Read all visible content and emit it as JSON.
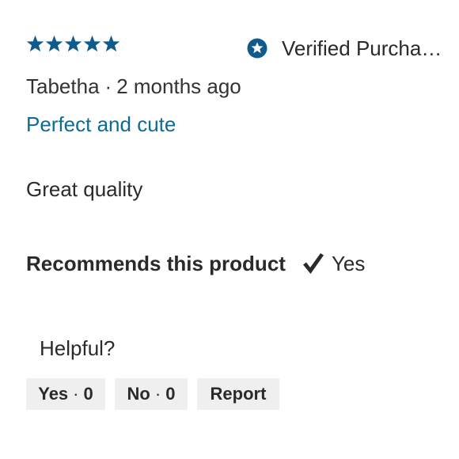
{
  "rating": {
    "stars": 5,
    "max_stars": 5,
    "star_color": "#0f5b8c"
  },
  "verified": {
    "icon": "verified-star-badge-icon",
    "label": "Verified Purchaser"
  },
  "reviewer": {
    "name": "Tabetha",
    "separator": "·",
    "time_ago": "2 months ago"
  },
  "review": {
    "title": "Perfect and cute",
    "title_color": "#0f6a96",
    "body": "Great quality"
  },
  "recommendation": {
    "label": "Recommends this product",
    "icon": "checkmark-icon",
    "value": "Yes"
  },
  "feedback": {
    "prompt": "Helpful?",
    "yes_label": "Yes",
    "yes_count": "0",
    "no_label": "No",
    "no_count": "0",
    "report_label": "Report",
    "separator": "·"
  }
}
